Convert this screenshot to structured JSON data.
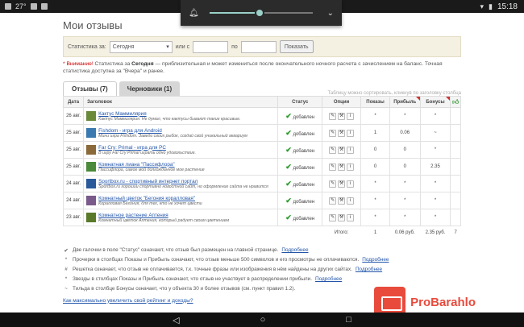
{
  "statusbar": {
    "temp": "27°",
    "time": "15:18"
  },
  "page_title": "Мои отзывы",
  "filter": {
    "stat_label": "Статистика за:",
    "period_value": "Сегодня",
    "or_label": "или с",
    "to_label": "по",
    "show_label": "Показать"
  },
  "warning": {
    "prefix": "* Внимание!",
    "text_a": " Статистика за ",
    "today": "Сегодня",
    "text_b": " — приблизительная и может измениться после окончательного ночного расчета с зачислением на баланс. Точная статистика доступна за \"Вчера\" и ранее."
  },
  "tabs": [
    {
      "label": "Отзывы (7)"
    },
    {
      "label": "Черновики (1)"
    }
  ],
  "tabs_note": "Таблицу можно сортировать, кликнув по заголовку столбца",
  "table": {
    "headers": [
      "Дата",
      "Заголовок",
      "Статус",
      "Опции",
      "Показы",
      "Прибыль",
      "Бонусы"
    ],
    "rows": [
      {
        "date": "26 авг.",
        "title": "Кактус Маммилярия",
        "sub": "Кактус Маммилярия. Не думал, что кактусы бывают такие красивые.",
        "status": "добавлен",
        "views": "*",
        "profit": "*",
        "bonus": "*",
        "thumb": "#6a8a3a"
      },
      {
        "date": "25 авг.",
        "title": "Fishdom - игра для Android",
        "sub": "Мини игра Fishdom. Заведи своих рыбок, создай свой уникальный аквариум",
        "status": "добавлен",
        "views": "1",
        "profit": "0.06",
        "bonus": "~",
        "thumb": "#3a7ab0"
      },
      {
        "date": "25 авг.",
        "title": "Far Cry: Primal - игра для PC",
        "sub": "В игру Far Cry Primal играть одно удовольствие.",
        "status": "добавлен",
        "views": "0",
        "profit": "0",
        "bonus": "*",
        "thumb": "#8a6a3a"
      },
      {
        "date": "25 авг.",
        "title": "Комнатная лиана \"Пассифлора\"",
        "sub": "Пассифлора, самое мой долгожданное мое растение",
        "status": "добавлен",
        "views": "0",
        "profit": "0",
        "bonus": "2.35",
        "thumb": "#4a8a3a"
      },
      {
        "date": "24 авг.",
        "title": "Sportbox.ru - спортивный интернет портал",
        "sub": "Sportbox.ru хороший спортивно новостной сайт, но оформление сайта не нравится",
        "status": "добавлен",
        "views": "*",
        "profit": "*",
        "bonus": "*",
        "thumb": "#2a5a9a"
      },
      {
        "date": "24 авг.",
        "title": "Комнатный цветок \"Бегония коралловая\"",
        "sub": "Коралловая Бегония, для тех, кто не хочет цвести",
        "status": "добавлен",
        "views": "*",
        "profit": "*",
        "bonus": "*",
        "thumb": "#7a5a8a"
      },
      {
        "date": "23 авг.",
        "title": "Комнатное растение Аптения",
        "sub": "Комнатный цветок Аптения, который радует своим цветением",
        "status": "добавлен",
        "views": "*",
        "profit": "*",
        "bonus": "*",
        "thumb": "#5a7a2a"
      }
    ],
    "total_label": "Итого:",
    "total_views": "1",
    "total_profit": "0.06 руб.",
    "total_bonus": "2.35 руб.",
    "total_extra": "7"
  },
  "notes": [
    {
      "mark": "✔",
      "text": "Две галочки в поле \"Статус\" означают, что отзыв был размещен на главной странице.",
      "link": "Подробнее"
    },
    {
      "mark": "*",
      "text": "Прочерки в столбцах Показы и Прибыль означают, что отзыв меньше 500 символов и его просмотры не оплачиваются.",
      "link": "Подробнее"
    },
    {
      "mark": "#",
      "text": "Решетка означает, что отзыв не оплачивается, т.к. точные фразы или изображения в нём найдены на других сайтах.",
      "link": "Подробнее"
    },
    {
      "mark": "*",
      "text": "Звезды в столбцах Показы и Прибыль означают, что отзыв не участвует в распределении прибыли.",
      "link": "Подробнее"
    },
    {
      "mark": "~",
      "text": "Тильда в столбце Бонусы означает, что у объекта 30 и более отзывов (см. пункт правил 1.2).",
      "link": ""
    }
  ],
  "more_link": "Как максимально увеличить свой рейтинг и доходы?",
  "watermark": "ProBarahlo"
}
